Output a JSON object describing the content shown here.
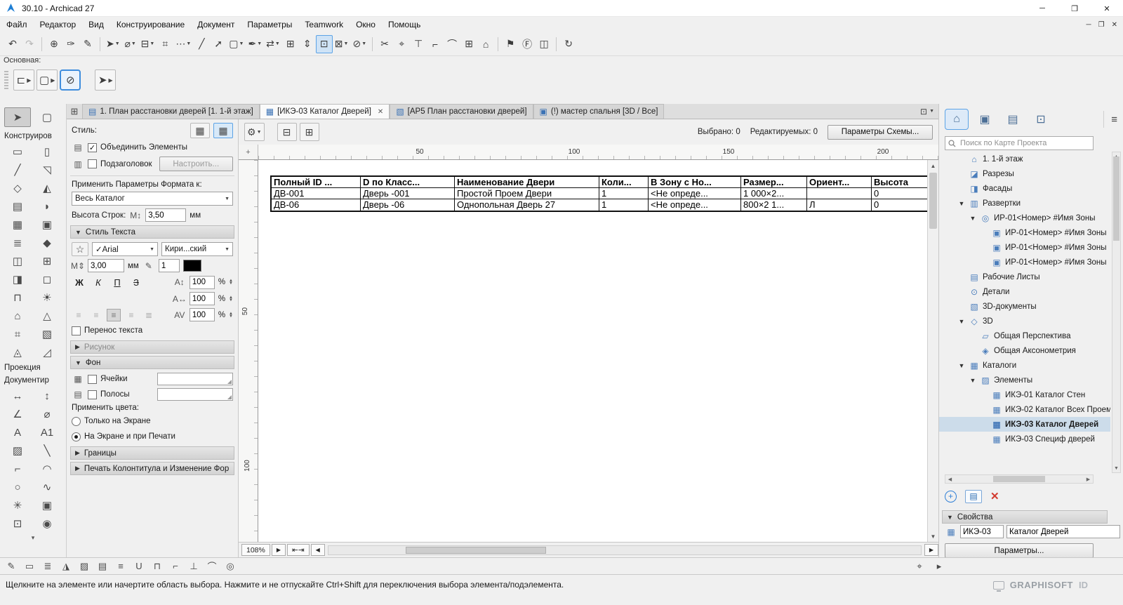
{
  "window": {
    "title": "30.10 - Archicad 27",
    "controls": {
      "minimize": "─",
      "maximize": "❐",
      "close": "✕"
    }
  },
  "menubar": {
    "items": [
      "Файл",
      "Редактор",
      "Вид",
      "Конструирование",
      "Документ",
      "Параметры",
      "Teamwork",
      "Окно",
      "Помощь"
    ]
  },
  "main_toolbar": {
    "items": [
      {
        "name": "undo-icon",
        "glyph": "↶"
      },
      {
        "name": "redo-icon",
        "glyph": "↷",
        "disabled": true
      },
      {
        "sep": true
      },
      {
        "name": "pick-up-parameters-icon",
        "glyph": "⊕"
      },
      {
        "name": "inject-parameters-icon",
        "glyph": "✑"
      },
      {
        "name": "parameter-brush-icon",
        "glyph": "✎"
      },
      {
        "sep": true
      },
      {
        "name": "selection-arrow-icon",
        "glyph": "➤",
        "caret": true
      },
      {
        "name": "measure-icon",
        "glyph": "⌀",
        "caret": true
      },
      {
        "name": "element-relation-icon",
        "glyph": "⊟",
        "caret": true
      },
      {
        "name": "grid-snap-icon",
        "glyph": "⌗"
      },
      {
        "name": "snap-points-icon",
        "glyph": "⋯",
        "caret": true
      },
      {
        "name": "guide-line-icon",
        "glyph": "╱"
      },
      {
        "name": "guide-segment-icon",
        "glyph": "➚"
      },
      {
        "name": "marquee-frame-icon",
        "glyph": "▢",
        "caret": true
      },
      {
        "name": "pen-color-icon",
        "glyph": "✒",
        "caret": true
      },
      {
        "name": "drag-icon",
        "glyph": "⇄",
        "caret": true
      },
      {
        "name": "multiply-icon",
        "glyph": "⊞"
      },
      {
        "name": "stretch-icon",
        "glyph": "⇕"
      },
      {
        "name": "subdivide-icon",
        "glyph": "⊡",
        "active": true
      },
      {
        "name": "intersect-icon",
        "glyph": "⊠",
        "caret": true
      },
      {
        "name": "mirror-icon",
        "glyph": "⊘",
        "caret": true
      },
      {
        "sep": true
      },
      {
        "name": "split-icon",
        "glyph": "✂"
      },
      {
        "name": "adjust-icon",
        "glyph": "⌖"
      },
      {
        "name": "trim-icon",
        "glyph": "⊤"
      },
      {
        "name": "corner-icon",
        "glyph": "⌐"
      },
      {
        "name": "fillet-icon",
        "glyph": "⌒"
      },
      {
        "name": "explode-icon",
        "glyph": "⊞"
      },
      {
        "name": "base-level-icon",
        "glyph": "⌂"
      },
      {
        "sep": true
      },
      {
        "name": "flag-icon",
        "glyph": "⚑"
      },
      {
        "name": "f-label-icon",
        "glyph": "Ⓕ"
      },
      {
        "name": "capture-icon",
        "glyph": "◫"
      },
      {
        "sep": true
      },
      {
        "name": "rotate-view-icon",
        "glyph": "↻"
      }
    ]
  },
  "toolbar2": {
    "label": "Основная:",
    "items": [
      {
        "name": "default-settings-icon",
        "glyph": "⊏",
        "caret": true
      },
      {
        "name": "marquee-options-icon",
        "glyph": "▢",
        "caret": true
      },
      {
        "name": "rotated-view-icon",
        "glyph": "⊘",
        "active": true
      },
      {
        "gap": true
      },
      {
        "name": "arrow-tool-icon",
        "glyph": "➤",
        "caret": true
      }
    ]
  },
  "tabs": {
    "items": [
      {
        "label": "1. План расстановки дверей [1. 1-й этаж]",
        "icon": "plan-tab-icon",
        "glyph": "▤"
      },
      {
        "label": "[ИКЭ-03 Каталог Дверей]",
        "icon": "schedule-tab-icon",
        "glyph": "▦",
        "active": true,
        "closable": true
      },
      {
        "label": "[AP5 План расстановки дверей]",
        "icon": "layout-tab-icon",
        "glyph": "▧"
      },
      {
        "label": "(!) мастер спальня [3D / Все]",
        "icon": "view3d-tab-icon",
        "glyph": "▣"
      }
    ],
    "close_glyph": "✕"
  },
  "toolbox": {
    "select_tools": [
      {
        "name": "arrow-tool",
        "glyph": "➤",
        "active": true
      },
      {
        "name": "marquee-tool",
        "glyph": "▢"
      }
    ],
    "sections": [
      {
        "label": "Конструиров",
        "tools": [
          {
            "name": "wall-tool",
            "glyph": "▭"
          },
          {
            "name": "column-tool",
            "glyph": "▯"
          },
          {
            "name": "beam-tool",
            "glyph": "╱"
          },
          {
            "name": "roof-tool",
            "glyph": "◹"
          },
          {
            "name": "zone-tool",
            "glyph": "◇"
          },
          {
            "name": "mesh-tool",
            "glyph": "◭"
          },
          {
            "name": "slab-tool",
            "glyph": "▤"
          },
          {
            "name": "shell-tool",
            "glyph": "◗"
          },
          {
            "name": "curtain-wall-tool",
            "glyph": "▦"
          },
          {
            "name": "object-tool",
            "glyph": "▣"
          },
          {
            "name": "stair-tool",
            "glyph": "≣"
          },
          {
            "name": "morph-tool",
            "glyph": "◆"
          },
          {
            "name": "door-tool",
            "glyph": "◫"
          },
          {
            "name": "window-tool",
            "glyph": "⊞"
          },
          {
            "name": "skylight-tool",
            "glyph": "◨"
          },
          {
            "name": "opening-tool",
            "glyph": "◻"
          },
          {
            "name": "railing-tool",
            "glyph": "⊓"
          },
          {
            "name": "lamp-tool",
            "glyph": "☀"
          },
          {
            "name": "equipment-tool",
            "glyph": "⌂"
          },
          {
            "name": "truss-tool",
            "glyph": "△"
          },
          {
            "name": "grid-element-tool",
            "glyph": "⌗"
          },
          {
            "name": "profile-tool",
            "glyph": "▧"
          },
          {
            "name": "ceiling-tool",
            "glyph": "◬"
          },
          {
            "name": "ramp-tool",
            "glyph": "◿"
          }
        ]
      },
      {
        "label": "Проекция",
        "tools": []
      },
      {
        "label": "Документир",
        "tools": [
          {
            "name": "dimension-tool",
            "glyph": "↔"
          },
          {
            "name": "level-dimension-tool",
            "glyph": "↕"
          },
          {
            "name": "angle-dimension-tool",
            "glyph": "∠"
          },
          {
            "name": "radial-dimension-tool",
            "glyph": "⌀"
          },
          {
            "name": "text-tool",
            "glyph": "A"
          },
          {
            "name": "label-tool",
            "glyph": "A1"
          },
          {
            "name": "fill-tool",
            "glyph": "▨"
          },
          {
            "name": "line-tool",
            "glyph": "╲"
          },
          {
            "name": "polyline-tool",
            "glyph": "⌐"
          },
          {
            "name": "arc-tool",
            "glyph": "◠"
          },
          {
            "name": "circle-tool",
            "glyph": "○"
          },
          {
            "name": "spline-tool",
            "glyph": "∿"
          },
          {
            "name": "hotspot-tool",
            "glyph": "✳"
          },
          {
            "name": "figure-tool",
            "glyph": "▣"
          },
          {
            "name": "drawing-tool",
            "glyph": "⊡"
          },
          {
            "name": "camera-tool",
            "glyph": "◉"
          }
        ]
      }
    ],
    "more_glyph": "▾"
  },
  "info": {
    "style_label": "Стиль:",
    "merge_elements_label": "Объединить Элементы",
    "subtitle_label": "Подзаголовок",
    "configure_button": "Настроить...",
    "apply_format_label": "Применить Параметры Формата к:",
    "apply_format_value": "Весь Каталог",
    "row_height_label": "Высота Строк:",
    "row_height_value": "3,50",
    "units_mm": "мм",
    "sections": {
      "text_style": "Стиль Текста",
      "drawing": "Рисунок",
      "background": "Фон",
      "borders": "Границы",
      "header_print": "Печать Колонтитула и Изменение Фор..."
    },
    "font_check": "✓",
    "font_value": "Arial",
    "script_value": "Кири...ский",
    "font_size_value": "3,00",
    "pen_value": "1",
    "format_buttons": [
      "Ж",
      "К",
      "П",
      "З"
    ],
    "spin_values": [
      "100",
      "100",
      "100"
    ],
    "percent": "%",
    "wrap_label": "Перенос текста",
    "cells_label": "Ячейки",
    "stripes_label": "Полосы",
    "apply_colors_label": "Применить цвета:",
    "radio_screen": "Только на Экране",
    "radio_screen_print": "На Экране и при Печати"
  },
  "schedule": {
    "selected_label": "Выбрано: 0",
    "editable_label": "Редактируемых: 0",
    "scheme_button": "Параметры Схемы...",
    "ruler_h": [
      "50",
      "100",
      "150",
      "200"
    ],
    "ruler_v": [
      "50",
      "100"
    ],
    "zoom_value": "108%",
    "table": {
      "headers": [
        "Полный ID ...",
        "D по Класс...",
        "Наименование Двери",
        "Коли...",
        "В Зону с Но...",
        "Размер...",
        "Ориент...",
        "Высота"
      ],
      "rows": [
        [
          "ДВ-001",
          "Дверь -001",
          "Простой Проем Двери",
          "1",
          "<Не опреде...",
          "1 000×2...",
          "",
          "0"
        ],
        [
          "ДВ-06",
          "Дверь -06",
          "Однопольная Дверь 27",
          "1",
          "<Не опреде...",
          "800×2 1...",
          "Л",
          "0"
        ]
      ]
    }
  },
  "navigator": {
    "tabs": [
      {
        "name": "project-map-tab",
        "glyph": "⌂",
        "active": true
      },
      {
        "name": "view-map-tab",
        "glyph": "▣"
      },
      {
        "name": "layout-book-tab",
        "glyph": "▤"
      },
      {
        "name": "publisher-tab",
        "glyph": "⊡"
      }
    ],
    "menu_glyph": "≡",
    "search_placeholder": "Поиск по Карте Проекта",
    "tree": [
      {
        "label": "1. 1-й этаж",
        "depth": 1,
        "icon": "story-icon"
      },
      {
        "label": "Разрезы",
        "depth": 1,
        "icon": "sections-icon"
      },
      {
        "label": "Фасады",
        "depth": 1,
        "icon": "elevations-icon"
      },
      {
        "label": "Развертки",
        "depth": 1,
        "icon": "interior-elevations-folder-icon",
        "expanded": true
      },
      {
        "label": "ИР-01<Номер> #Имя Зоны",
        "depth": 2,
        "icon": "interior-elevation-group-icon",
        "expanded": true
      },
      {
        "label": "ИР-01<Номер> #Имя Зоны",
        "depth": 3,
        "icon": "interior-elevation-icon"
      },
      {
        "label": "ИР-01<Номер> #Имя Зоны",
        "depth": 3,
        "icon": "interior-elevation-icon"
      },
      {
        "label": "ИР-01<Номер> #Имя Зоны",
        "depth": 3,
        "icon": "interior-elevation-icon"
      },
      {
        "label": "Рабочие Листы",
        "depth": 1,
        "icon": "worksheets-icon"
      },
      {
        "label": "Детали",
        "depth": 1,
        "icon": "details-icon"
      },
      {
        "label": "3D-документы",
        "depth": 1,
        "icon": "documents-3d-icon"
      },
      {
        "label": "3D",
        "depth": 1,
        "icon": "folder-3d-icon",
        "expanded": true
      },
      {
        "label": "Общая Перспектива",
        "depth": 2,
        "icon": "perspective-icon"
      },
      {
        "label": "Общая Аксонометрия",
        "depth": 2,
        "icon": "axonometry-icon"
      },
      {
        "label": "Каталоги",
        "depth": 1,
        "icon": "schedules-icon",
        "expanded": true
      },
      {
        "label": "Элементы",
        "depth": 2,
        "icon": "elements-icon",
        "expanded": true
      },
      {
        "label": "ИКЭ-01 Каталог Стен",
        "depth": 3,
        "icon": "schedule-item-icon"
      },
      {
        "label": "ИКЭ-02 Каталог Всех Проем",
        "depth": 3,
        "icon": "schedule-item-icon"
      },
      {
        "label": "ИКЭ-03 Каталог Дверей",
        "depth": 3,
        "icon": "schedule-item-icon",
        "selected": true
      },
      {
        "label": "ИКЭ-03 Специф дверей",
        "depth": 3,
        "icon": "schedule-item-icon"
      }
    ],
    "properties_header": "Свойства",
    "id_value": "ИКЭ-03",
    "name_value": "Каталог Дверей",
    "params_button": "Параметры..."
  },
  "bottom_toolbar": {
    "items": [
      {
        "name": "pen-set-icon",
        "glyph": "✎"
      },
      {
        "name": "line-type-icon",
        "glyph": "▭"
      },
      {
        "name": "layers-icon",
        "glyph": "≣"
      },
      {
        "name": "surface-icon",
        "glyph": "◮"
      },
      {
        "name": "fill-type-icon",
        "glyph": "▨"
      },
      {
        "name": "composite-icon",
        "glyph": "▤"
      },
      {
        "name": "profile-icon",
        "glyph": "≡"
      },
      {
        "name": "underlay-icon",
        "glyph": "U"
      },
      {
        "name": "text-style-icon",
        "glyph": "⊓"
      },
      {
        "name": "dimension-style-icon",
        "glyph": "⌐"
      },
      {
        "name": "anchor-icon",
        "glyph": "⊥"
      },
      {
        "name": "section-depth-icon",
        "glyph": "⌒"
      },
      {
        "name": "snap-guides-icon",
        "glyph": "◎"
      }
    ],
    "right_items": [
      {
        "name": "coordinates-icon",
        "glyph": "⌖"
      },
      {
        "name": "tracker-caret-icon",
        "glyph": "▸"
      }
    ]
  },
  "statusbar": {
    "message": "Щелкните на элементе или начертите область выбора. Нажмите и не отпускайте Ctrl+Shift для переключения выбора элемента/подэлемента.",
    "brand": "GRAPHISOFT",
    "brand_id": "ID"
  }
}
